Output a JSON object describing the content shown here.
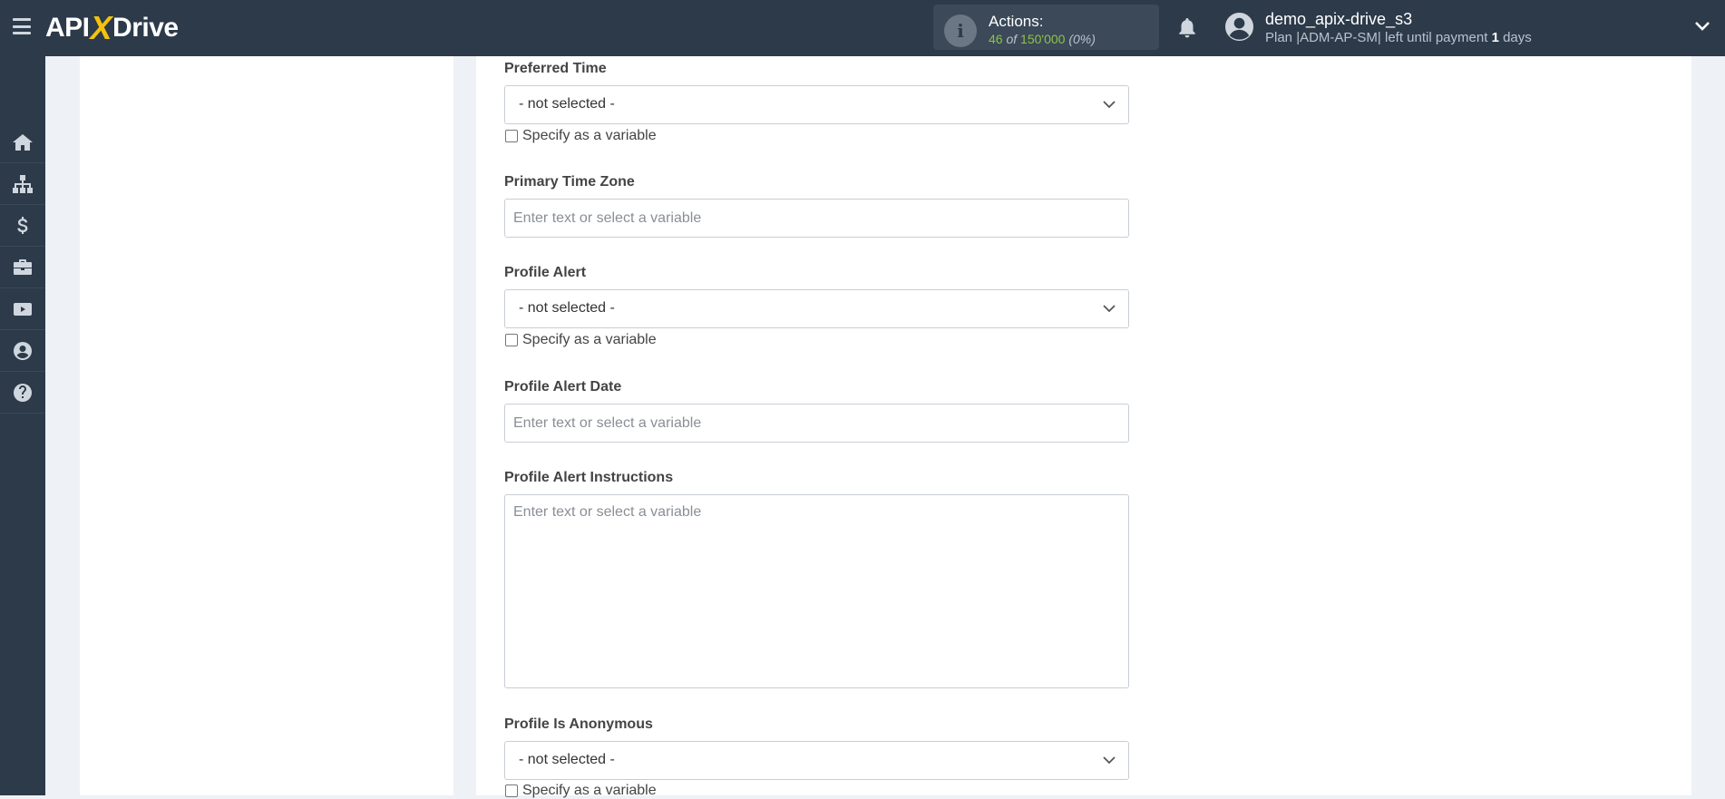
{
  "header": {
    "logo_left": "API",
    "logo_x": "X",
    "logo_right": "Drive",
    "actions_label": "Actions:",
    "actions_used": "46",
    "actions_of": "of",
    "actions_total": "150'000",
    "actions_pct": "(0%)",
    "user_name": "demo_apix-drive_s3",
    "plan_prefix": "Plan |ADM-AP-SM| left until payment",
    "plan_days": "1",
    "plan_suffix": "days"
  },
  "sidebar": {
    "items": [
      {
        "icon": "home-icon"
      },
      {
        "icon": "sitemap-icon"
      },
      {
        "icon": "dollar-icon"
      },
      {
        "icon": "briefcase-icon"
      },
      {
        "icon": "youtube-icon"
      },
      {
        "icon": "user-circle-icon"
      },
      {
        "icon": "help-icon"
      }
    ]
  },
  "form": {
    "preferred_time": {
      "label": "Preferred Time",
      "value": "- not selected -",
      "checkbox": "Specify as a variable"
    },
    "primary_time_zone": {
      "label": "Primary Time Zone",
      "placeholder": "Enter text or select a variable"
    },
    "profile_alert": {
      "label": "Profile Alert",
      "value": "- not selected -",
      "checkbox": "Specify as a variable"
    },
    "profile_alert_date": {
      "label": "Profile Alert Date",
      "placeholder": "Enter text or select a variable"
    },
    "profile_alert_instructions": {
      "label": "Profile Alert Instructions",
      "placeholder": "Enter text or select a variable"
    },
    "profile_is_anonymous": {
      "label": "Profile Is Anonymous",
      "value": "- not selected -",
      "checkbox": "Specify as a variable"
    }
  },
  "colors": {
    "topbar": "#2c3a4a",
    "accent_yellow": "#f4c20d",
    "accent_green": "#8bc34a",
    "background": "#eef1f6"
  }
}
